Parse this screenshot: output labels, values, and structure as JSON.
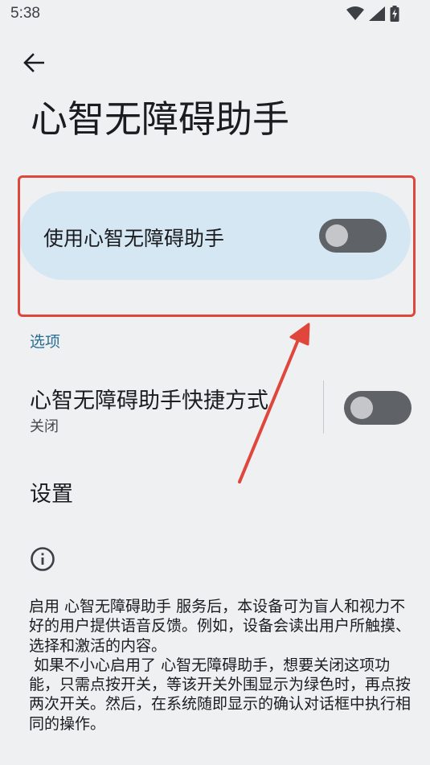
{
  "status_bar": {
    "time": "5:38",
    "icons": [
      "wifi-icon",
      "cellular-signal-icon",
      "battery-charging-icon"
    ]
  },
  "header": {
    "back_icon": "arrow-back-icon",
    "title": "心智无障碍助手"
  },
  "main_toggle": {
    "label": "使用心智无障碍助手",
    "checked": false
  },
  "options_section": {
    "header": "选项",
    "shortcut": {
      "title": "心智无障碍助手快捷方式",
      "summary": "关闭",
      "checked": false
    },
    "settings": {
      "label": "设置"
    }
  },
  "info": {
    "icon": "info-icon",
    "description": "启用 心智无障碍助手 服务后，本设备可为盲人和视力不好的用户提供语音反馈。例如，设备会读出用户所触摸、选择和激活的内容。\n 如果不小心启用了 心智无障碍助手，想要关闭这项功能，只需点按开关，等该开关外围显示为绿色时，再点按两次开关。然后，在系统随即显示的确认对话框中执行相同的操作。"
  },
  "colors": {
    "background": "#eef0f2",
    "card_highlight": "#d6e7f4",
    "accent": "#2a6d93",
    "annotation_red": "#e0463c",
    "switch_off_track": "#5f6367"
  }
}
